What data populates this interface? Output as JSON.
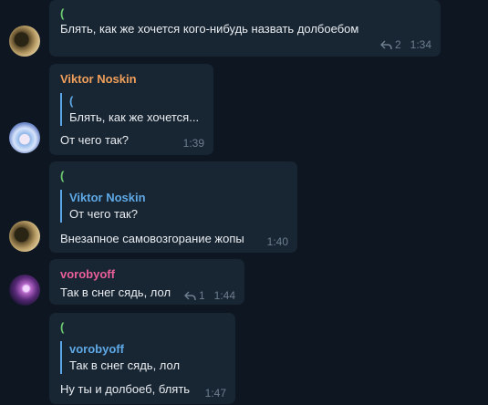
{
  "messages": [
    {
      "reply_name": "(",
      "text": "Блять, как же хочется кого-нибудь назвать долбоебом",
      "replies_count": "2",
      "time": "1:34"
    },
    {
      "sender": "Viktor Noskin",
      "reply_name": "(",
      "reply_text": "Блять, как же хочется...",
      "text": "От чего так?",
      "time": "1:39"
    },
    {
      "reply_top": "(",
      "reply_name": "Viktor Noskin",
      "reply_text": "От чего так?",
      "text": "Внезапное самовозгорание жопы",
      "time": "1:40"
    },
    {
      "sender": "vorobyoff",
      "text": "Так в снег сядь, лол",
      "replies_count": "1",
      "time": "1:44"
    },
    {
      "reply_top": "(",
      "reply_name": "vorobyoff",
      "reply_text": "Так в снег сядь, лол",
      "text": "Ну ты и долбоеб, блять",
      "time": "1:47"
    }
  ],
  "colors": {
    "background": "#0e1621",
    "bubble": "#182533",
    "sender_viktor": "#f0a05a",
    "sender_vorobyoff": "#ea5f9a",
    "reply_accent": "#5aa6e6",
    "paren": "#6dcc6f",
    "meta": "#6d7f8f"
  },
  "icons": [
    "reply-arrow-icon"
  ]
}
